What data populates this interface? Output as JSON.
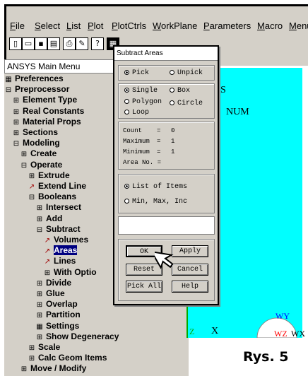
{
  "menubar": {
    "items": [
      "File",
      "Select",
      "List",
      "Plot",
      "PlotCtrls",
      "WorkPlane",
      "Parameters",
      "Macro",
      "Menu"
    ]
  },
  "toolbar": {
    "icons": [
      "new-file-icon",
      "open-folder-icon",
      "save-icon",
      "report-icon",
      "print-icon",
      "edit-icon",
      "help-icon",
      "command-window-icon"
    ]
  },
  "main_menu": {
    "title": "ANSYS Main Menu",
    "items": [
      {
        "label": "Preferences",
        "icon": "table-icon"
      },
      {
        "label": "Preprocessor",
        "icon": "minus-box-icon"
      },
      {
        "label": "Element Type",
        "icon": "plus-box-icon"
      },
      {
        "label": "Real Constants",
        "icon": "plus-box-icon"
      },
      {
        "label": "Material Props",
        "icon": "plus-box-icon"
      },
      {
        "label": "Sections",
        "icon": "plus-box-icon"
      },
      {
        "label": "Modeling",
        "icon": "minus-box-icon"
      },
      {
        "label": "Create",
        "icon": "plus-box-icon"
      },
      {
        "label": "Operate",
        "icon": "minus-box-icon"
      },
      {
        "label": "Extrude",
        "icon": "plus-box-icon"
      },
      {
        "label": "Extend Line",
        "icon": "pick-arrow-icon"
      },
      {
        "label": "Booleans",
        "icon": "minus-box-icon"
      },
      {
        "label": "Intersect",
        "icon": "plus-box-icon"
      },
      {
        "label": "Add",
        "icon": "plus-box-icon"
      },
      {
        "label": "Subtract",
        "icon": "minus-box-icon"
      },
      {
        "label": "Volumes",
        "icon": "pick-arrow-icon"
      },
      {
        "label": "Areas",
        "icon": "pick-arrow-icon",
        "selected": true
      },
      {
        "label": "Lines",
        "icon": "pick-arrow-icon"
      },
      {
        "label": "With Optio",
        "icon": "plus-box-icon"
      },
      {
        "label": "Divide",
        "icon": "plus-box-icon"
      },
      {
        "label": "Glue",
        "icon": "plus-box-icon"
      },
      {
        "label": "Overlap",
        "icon": "plus-box-icon"
      },
      {
        "label": "Partition",
        "icon": "plus-box-icon"
      },
      {
        "label": "Settings",
        "icon": "table-icon"
      },
      {
        "label": "Show Degeneracy",
        "icon": "plus-box-icon"
      },
      {
        "label": "Scale",
        "icon": "plus-box-icon"
      },
      {
        "label": "Calc Geom Items",
        "icon": "plus-box-icon"
      },
      {
        "label": "Move / Modify",
        "icon": "plus-box-icon"
      }
    ]
  },
  "graphics": {
    "label_s": "S",
    "label_num": "NUM",
    "label_wy": "WY",
    "label_wz": "WZ",
    "label_wx": "WX",
    "label_z": "Z",
    "label_x": "X"
  },
  "dialog": {
    "title": "Subtract Areas",
    "mode_pick": "Pick",
    "mode_unpick": "Unpick",
    "shape_single": "Single",
    "shape_box": "Box",
    "shape_polygon": "Polygon",
    "shape_circle": "Circle",
    "shape_loop": "Loop",
    "count_label": "Count",
    "count_value": "0",
    "maximum_label": "Maximum",
    "maximum_value": "1",
    "minimum_label": "Minimum",
    "minimum_value": "1",
    "area_no_label": "Area No. =",
    "eq": "=",
    "list_of_items": "List of Items",
    "min_max_inc": "Min, Max, Inc",
    "input_value": "",
    "ok": "OK",
    "apply": "Apply",
    "reset": "Reset",
    "cancel": "Cancel",
    "pick_all": "Pick All",
    "help": "Help"
  },
  "caption": "Rys. 5",
  "colors": {
    "graphics_fill": "#00ffff",
    "selection": "#000080",
    "wy": "#0000ff",
    "wz": "#ff0000",
    "pick_arrow": "#a00000"
  }
}
